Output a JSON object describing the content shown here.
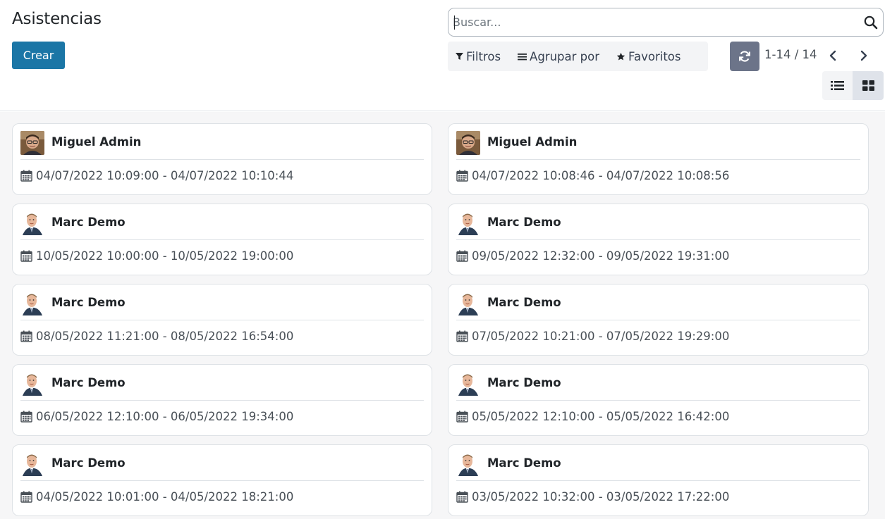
{
  "header": {
    "title": "Asistencias",
    "create_label": "Crear"
  },
  "search": {
    "placeholder": "Buscar...",
    "icon": "search-icon"
  },
  "filters": {
    "filter_label": "Filtros",
    "group_by_label": "Agrupar por",
    "favorites_label": "Favoritos"
  },
  "pager": {
    "value": "1-14 / 14"
  },
  "colors": {
    "primary": "#1b76a6",
    "refresh_bg": "#6c7489",
    "content_bg": "#f6f6f7"
  },
  "records": [
    {
      "employee": "Miguel Admin",
      "avatar": "admin",
      "period": "04/07/2022 10:09:00 - 04/07/2022 10:10:44"
    },
    {
      "employee": "Miguel Admin",
      "avatar": "admin",
      "period": "04/07/2022 10:08:46 - 04/07/2022 10:08:56"
    },
    {
      "employee": "Marc Demo",
      "avatar": "demo",
      "period": "10/05/2022 10:00:00 - 10/05/2022 19:00:00"
    },
    {
      "employee": "Marc Demo",
      "avatar": "demo",
      "period": "09/05/2022 12:32:00 - 09/05/2022 19:31:00"
    },
    {
      "employee": "Marc Demo",
      "avatar": "demo",
      "period": "08/05/2022 11:21:00 - 08/05/2022 16:54:00"
    },
    {
      "employee": "Marc Demo",
      "avatar": "demo",
      "period": "07/05/2022 10:21:00 - 07/05/2022 19:29:00"
    },
    {
      "employee": "Marc Demo",
      "avatar": "demo",
      "period": "06/05/2022 12:10:00 - 06/05/2022 19:34:00"
    },
    {
      "employee": "Marc Demo",
      "avatar": "demo",
      "period": "05/05/2022 12:10:00 - 05/05/2022 16:42:00"
    },
    {
      "employee": "Marc Demo",
      "avatar": "demo",
      "period": "04/05/2022 10:01:00 - 04/05/2022 18:21:00"
    },
    {
      "employee": "Marc Demo",
      "avatar": "demo",
      "period": "03/05/2022 10:32:00 - 03/05/2022 17:22:00"
    }
  ]
}
